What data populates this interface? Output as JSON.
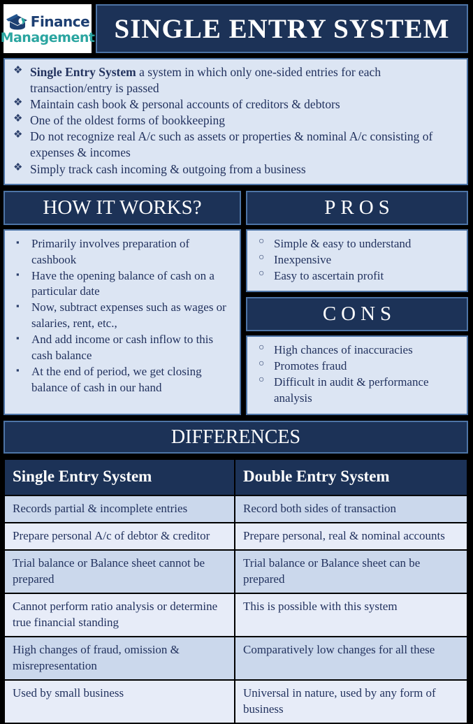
{
  "logo": {
    "icon": "graduation-cap-icon",
    "line1": "Finance",
    "line2": "Management",
    "color_primary": "#1d3f72",
    "color_secondary": "#2aa5a0"
  },
  "header": {
    "title": "SINGLE ENTRY SYSTEM"
  },
  "theme": {
    "navy": "#1c3257",
    "navy_border": "#4d74a6",
    "light_panel": "#dce5f3",
    "text_blue": "#22325e",
    "row_shade_a": "#cbd8ec",
    "row_shade_b": "#e7ecf8",
    "page_background": "#000000"
  },
  "intro": {
    "bullet_glyph": "❖",
    "items": [
      {
        "lead": "Single Entry System",
        "text": " a system in which only one-sided entries for each transaction/entry is passed"
      },
      {
        "lead": "",
        "text": "Maintain cash book & personal accounts of creditors & debtors"
      },
      {
        "lead": "",
        "text": "One of the oldest forms of bookkeeping"
      },
      {
        "lead": "",
        "text": "Do not recognize real A/c such as assets or properties & nominal A/c consisting of expenses & incomes"
      },
      {
        "lead": "",
        "text": "Simply track cash incoming & outgoing from a business"
      }
    ]
  },
  "how_it_works": {
    "heading": "HOW IT WORKS?",
    "bullet_glyph": "▪",
    "items": [
      "Primarily involves preparation of cashbook",
      "Have the opening balance of cash on a particular date",
      "Now, subtract expenses such as wages or salaries, rent, etc.,",
      "And add income or cash inflow to this cash balance",
      "At the end of period, we get closing balance of cash in our hand"
    ]
  },
  "pros": {
    "heading": "PROS",
    "bullet_glyph": "○",
    "items": [
      "Simple & easy to understand",
      "Inexpensive",
      "Easy to ascertain profit"
    ]
  },
  "cons": {
    "heading": "CONS",
    "bullet_glyph": "○",
    "items": [
      "High chances of inaccuracies",
      "Promotes fraud",
      "Difficult in audit & performance analysis"
    ]
  },
  "differences": {
    "heading": "DIFFERENCES",
    "columns": [
      "Single Entry System",
      "Double Entry System"
    ],
    "rows": [
      [
        "Records partial & incomplete entries",
        "Record both sides of transaction"
      ],
      [
        "Prepare personal A/c of debtor & creditor",
        "Prepare personal, real & nominal accounts"
      ],
      [
        "Trial balance or Balance sheet cannot be prepared",
        "Trial balance or Balance sheet can be prepared"
      ],
      [
        "Cannot perform ratio analysis or determine true financial standing",
        "This is possible with this system"
      ],
      [
        "High changes of fraud, omission & misrepresentation",
        "Comparatively low changes for all these"
      ],
      [
        "Used by small business",
        "Universal in nature, used by any form of business"
      ]
    ]
  }
}
